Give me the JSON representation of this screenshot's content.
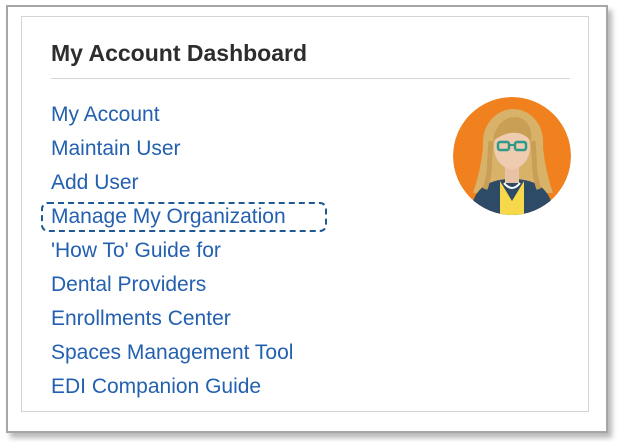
{
  "dashboard": {
    "title": "My Account Dashboard",
    "links": [
      {
        "label": "My Account"
      },
      {
        "label": "Maintain User"
      },
      {
        "label": "Add User"
      },
      {
        "label": "Manage My Organization",
        "highlighted": true
      },
      {
        "label": "'How To' Guide for"
      },
      {
        "label": "Dental Providers"
      },
      {
        "label": "Enrollments Center"
      },
      {
        "label": "Spaces Management Tool"
      },
      {
        "label": "EDI Companion Guide"
      }
    ],
    "avatar": {
      "icon": "user-avatar-icon",
      "background_color": "#f0811e"
    }
  },
  "colors": {
    "link": "#2460b0",
    "title": "#2d2d2d",
    "focus_ring": "#1e5a96"
  }
}
